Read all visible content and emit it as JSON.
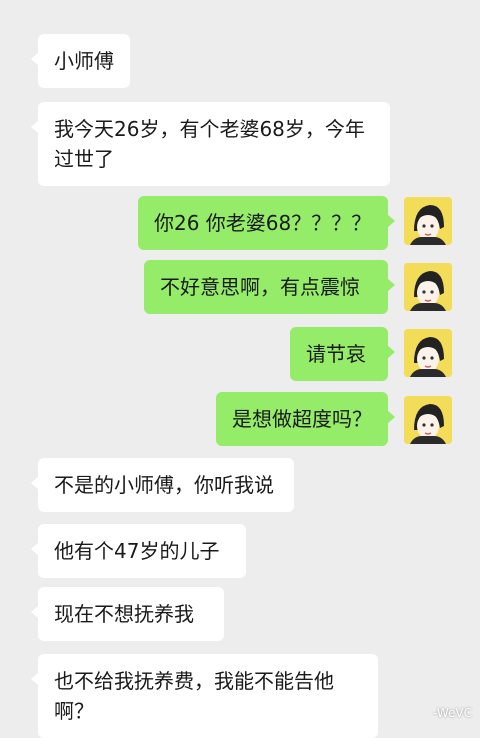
{
  "messages": [
    {
      "side": "left",
      "text": "小师傅"
    },
    {
      "side": "left",
      "text": "我今天26岁，有个老婆68岁，今年过世了"
    },
    {
      "side": "right",
      "text": "你26 你老婆68？？？？"
    },
    {
      "side": "right",
      "text": "不好意思啊，有点震惊"
    },
    {
      "side": "right",
      "text": "请节哀"
    },
    {
      "side": "right",
      "text": "是想做超度吗？"
    },
    {
      "side": "left",
      "text": "不是的小师傅，你听我说"
    },
    {
      "side": "left",
      "text": "他有个47岁的儿子"
    },
    {
      "side": "left",
      "text": "现在不想抚养我"
    },
    {
      "side": "left",
      "text": "也不给我抚养费，我能不能告他啊？"
    }
  ],
  "watermark": "-WeVC",
  "colors": {
    "background": "#ededed",
    "incoming_bubble": "#ffffff",
    "outgoing_bubble": "#95ec69",
    "avatar_background": "#f2dc58"
  },
  "icons": {
    "avatar": "monk-cartoon-avatar"
  }
}
